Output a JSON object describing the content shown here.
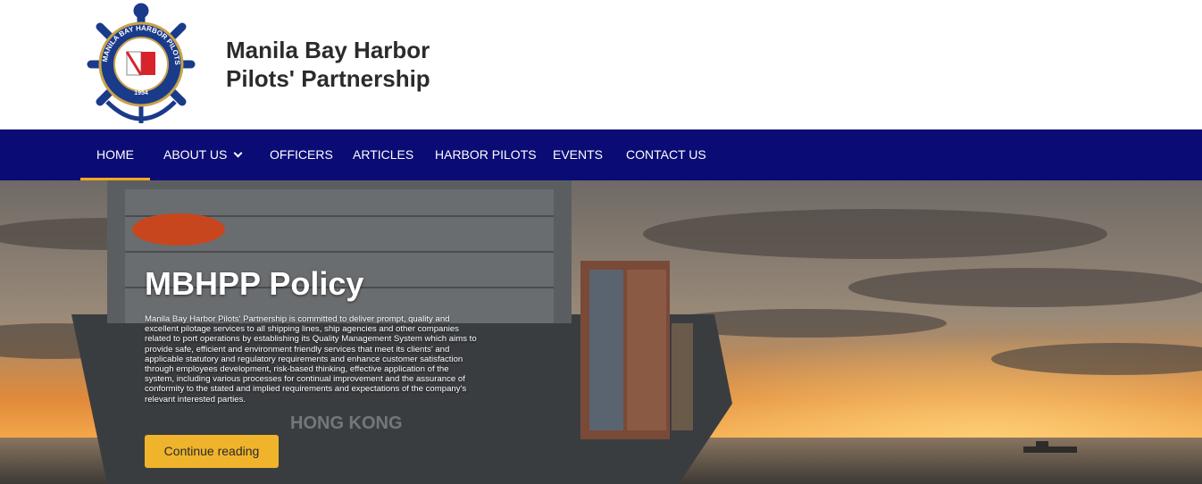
{
  "site": {
    "name_line1": "Manila Bay Harbor",
    "name_line2": "Pilots' Partnership",
    "logo_text": "MANILA BAY HARBOR PILOTS' PARTNERSHIP",
    "logo_year": "1954"
  },
  "nav": {
    "items": [
      {
        "label": "HOME",
        "active": true
      },
      {
        "label": "ABOUT US",
        "has_dropdown": true
      },
      {
        "label": "OFFICERS"
      },
      {
        "label": "ARTICLES"
      },
      {
        "label": "HARBOR PILOTS"
      },
      {
        "label": "EVENTS"
      },
      {
        "label": "CONTACT US"
      }
    ]
  },
  "hero": {
    "title": "MBHPP Policy",
    "body": "Manila Bay Harbor Pilots' Partnership is committed to deliver prompt, quality and excellent pilotage services to all shipping lines, ship agencies and other companies related to port operations by establishing its Quality Management System which aims to provide safe, efficient and environment friendly services that meet its clients' and applicable statutory and regulatory requirements and enhance customer satisfaction through employees development, risk-based thinking, effective application of the system, including various processes for continual improvement and the assurance of conformity to the stated and implied requirements and expectations of the company's relevant interested parties.",
    "button_label": "Continue reading",
    "ship_text": "HONG KONG"
  },
  "colors": {
    "nav_bg": "#0b0b76",
    "active_underline": "#f5a623",
    "button_bg": "#f0b42c",
    "logo_blue": "#1a3a8a"
  }
}
